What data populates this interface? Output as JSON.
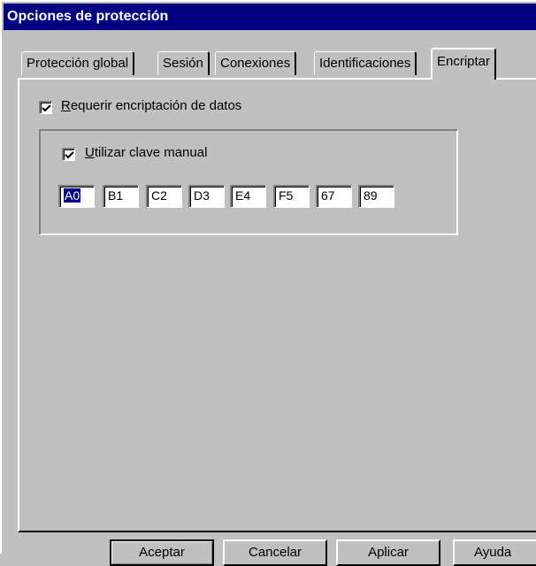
{
  "window": {
    "title": "Opciones de protección"
  },
  "tabs": [
    {
      "label": "Protección global",
      "active": false
    },
    {
      "label": "Sesión",
      "active": false
    },
    {
      "label": "Conexiones",
      "active": false
    },
    {
      "label": "Identificaciones",
      "active": false
    },
    {
      "label": "Encriptar",
      "active": true
    }
  ],
  "encrypt": {
    "require_accel": "R",
    "require_rest": "equerir encriptación de datos",
    "require_checked": true,
    "manual_accel": "U",
    "manual_rest": "tilizar clave manual",
    "manual_checked": true,
    "key_fields": [
      "A0",
      "B1",
      "C2",
      "D3",
      "E4",
      "F5",
      "67",
      "89"
    ]
  },
  "buttons": {
    "ok": "Aceptar",
    "cancel": "Cancelar",
    "apply": "Aplicar",
    "help": "Ayuda"
  }
}
